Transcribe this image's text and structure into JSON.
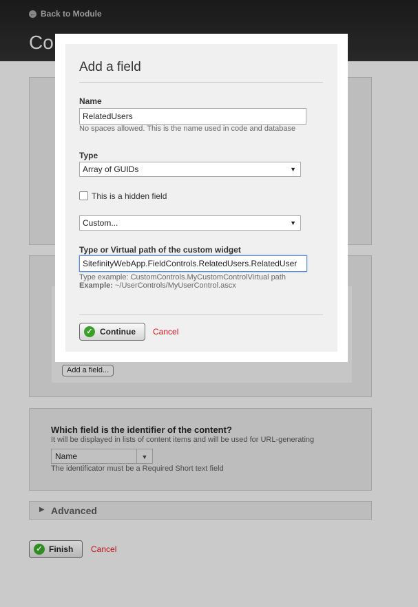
{
  "header": {
    "back_label": "Back to Module",
    "title_fragment": "Co"
  },
  "content_fields": {
    "add_field_label": "Add a field..."
  },
  "identifier": {
    "question": "Which field is the identifier of the content?",
    "description": "It will be displayed in lists of content items and will be used for URL-generating",
    "selected": "Name",
    "hint": "The identificator must be a Required Short text field"
  },
  "advanced": {
    "label": "Advanced"
  },
  "footer": {
    "finish_label": "Finish",
    "cancel_label": "Cancel"
  },
  "dialog": {
    "title": "Add a field",
    "name_label": "Name",
    "name_value": "RelatedUsers",
    "name_hint": "No spaces allowed. This is the name used in code and database",
    "type_label": "Type",
    "type_selected": "Array of GUIDs",
    "hidden_label": "This is a hidden field",
    "hidden_checked": false,
    "widget_selected": "Custom...",
    "widget_path_label": "Type or Virtual path of the custom widget",
    "widget_path_value": "SitefinityWebApp.FieldControls.RelatedUsers.RelatedUser",
    "type_example": "Type example: CustomControls.MyCustomControlVirtual path",
    "example_prefix": "Example:",
    "example_value": "~/UserControls/MyUserControl.ascx",
    "continue_label": "Continue",
    "cancel_label": "Cancel"
  },
  "colors": {
    "cancel_red": "#d3141a",
    "check_green": "#3aa02a",
    "focus_blue": "#5b8fd6"
  },
  "icons": {
    "back": "back-arrow-icon",
    "check": "check-icon",
    "dropdown": "chevron-down-icon",
    "expand": "triangle-right-icon"
  }
}
